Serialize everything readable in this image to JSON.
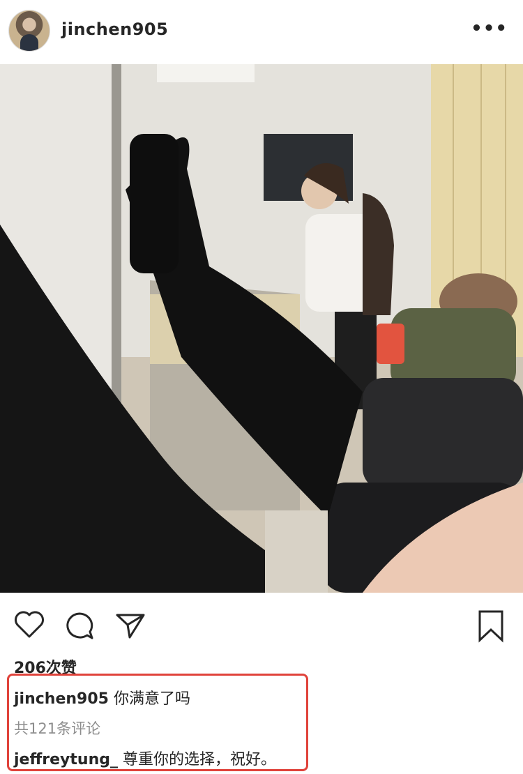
{
  "post": {
    "username": "jinchen905",
    "more_label": "•••"
  },
  "photo": {
    "alt": ""
  },
  "actions": {
    "like_icon": "heart-icon",
    "comment_icon": "comment-bubble-icon",
    "share_icon": "paper-plane-icon",
    "save_icon": "bookmark-icon"
  },
  "likes_text": "206次赞",
  "caption": {
    "username": "jinchen905",
    "text": "你满意了吗"
  },
  "view_comments_text": "共121条评论",
  "top_comment": {
    "username": "jeffreytung_",
    "text": "尊重你的选择，祝好。"
  },
  "colors": {
    "highlight_border": "#e0433b",
    "text": "#262626",
    "muted": "#8e8e8e"
  }
}
